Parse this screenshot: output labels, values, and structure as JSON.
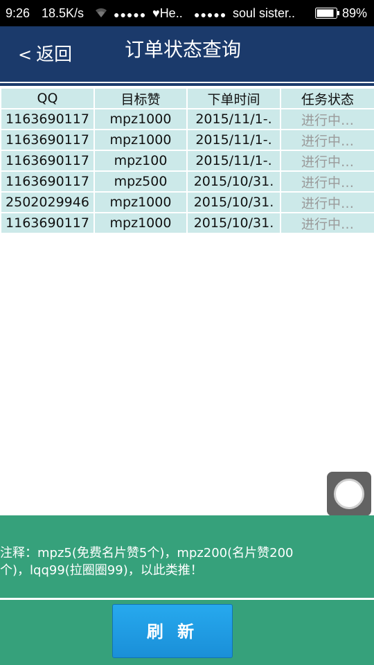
{
  "status_bar": {
    "time": "9:26",
    "net_speed": "18.5K/s",
    "wifi_icon": "wifi-icon",
    "signal1_dots": "●●●●●",
    "carrier1": "♥He..",
    "signal2_dots": "●●●●●",
    "carrier2": "soul sister..",
    "battery_icon": "battery-icon",
    "battery_level": "89%",
    "battery_fraction": 0.89
  },
  "header": {
    "back_chevron": "<",
    "back_label": "返回",
    "title": "订单状态查询",
    "background_color": "#1b3a6b"
  },
  "orders_table": {
    "columns": [
      "QQ",
      "目标赞",
      "下单时间",
      "任务状态"
    ],
    "rows": [
      {
        "qq": "1163690117",
        "target": "mpz1000",
        "time": "2015/11/1-.",
        "status": "进行中…"
      },
      {
        "qq": "1163690117",
        "target": "mpz1000",
        "time": "2015/11/1-.",
        "status": "进行中…"
      },
      {
        "qq": "1163690117",
        "target": "mpz100",
        "time": "2015/11/1-.",
        "status": "进行中…"
      },
      {
        "qq": "1163690117",
        "target": "mpz500",
        "time": "2015/10/31.",
        "status": "进行中…"
      },
      {
        "qq": "2502029946",
        "target": "mpz1000",
        "time": "2015/10/31.",
        "status": "进行中…"
      },
      {
        "qq": "1163690117",
        "target": "mpz1000",
        "time": "2015/10/31.",
        "status": "进行中…"
      }
    ],
    "cell_color": "#cce9e9",
    "status_color": "#9a9a9a"
  },
  "floating_button": {
    "icon": "assistive-touch-icon"
  },
  "footer": {
    "note": "注释：mpz5(免费名片赞5个)，mpz200(名片赞200个)，lqq99(拉圈圈99)，以此类推！",
    "refresh_label": "刷 新",
    "background_color": "#36a17b",
    "button_color": "#27a9ee"
  }
}
